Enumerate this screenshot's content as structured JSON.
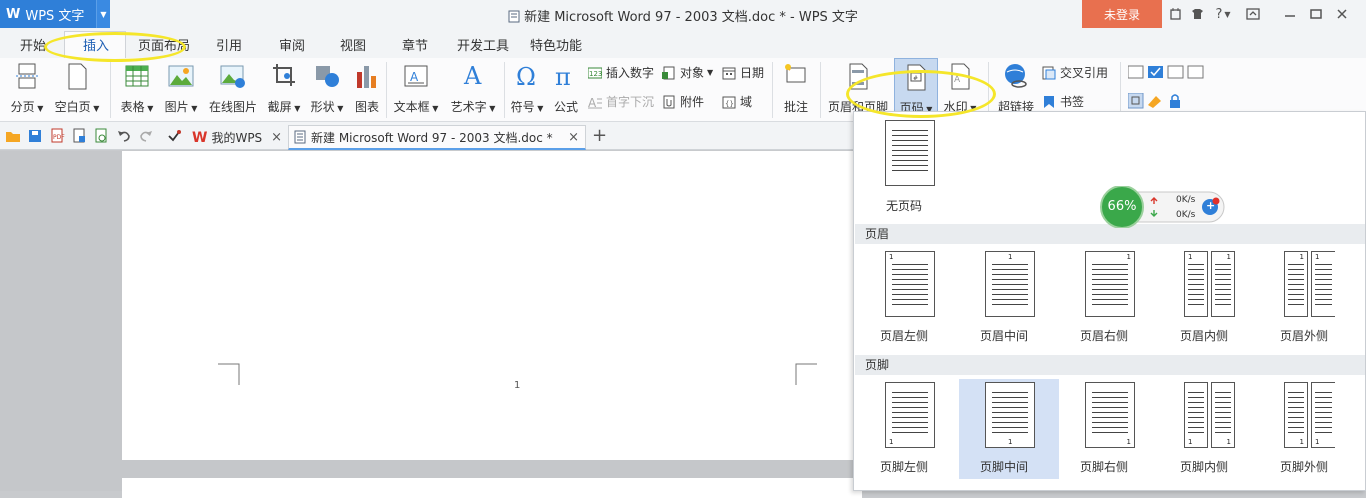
{
  "titlebar": {
    "app_name": "WPS 文字",
    "document_title": "新建 Microsoft Word 97 - 2003 文档.doc * - WPS 文字",
    "login_label": "未登录",
    "help_label": "?"
  },
  "ribbon_tabs": [
    "开始",
    "插入",
    "页面布局",
    "引用",
    "审阅",
    "视图",
    "章节",
    "开发工具",
    "特色功能"
  ],
  "ribbon": {
    "page_break": "分页",
    "blank_page": "空白页",
    "table": "表格",
    "picture": "图片",
    "online_picture": "在线图片",
    "screenshot": "截屏",
    "shape": "形状",
    "chart": "图表",
    "text_box": "文本框",
    "word_art": "艺术字",
    "symbol": "符号",
    "formula": "公式",
    "insert_number": "插入数字",
    "object": "对象",
    "date": "日期",
    "drop_cap": "首字下沉",
    "attachment": "附件",
    "field": "域",
    "comment": "批注",
    "header_footer": "页眉和页脚",
    "page_number": "页码",
    "watermark": "水印",
    "hyperlink": "超链接",
    "cross_ref": "交叉引用",
    "bookmark": "书签"
  },
  "doc_tabs": {
    "my_wps": "我的WPS",
    "current_doc": "新建 Microsoft Word 97 - 2003 文档.doc *",
    "close": "×",
    "add": "+"
  },
  "document": {
    "footer_page_number": "1"
  },
  "dropdown": {
    "none_label": "无页码",
    "header_section": "页眉",
    "footer_section": "页脚",
    "header_options": [
      "页眉左侧",
      "页眉中间",
      "页眉右侧",
      "页眉内侧",
      "页眉外侧"
    ],
    "footer_options": [
      "页脚左侧",
      "页脚中间",
      "页脚右侧",
      "页脚内侧",
      "页脚外侧"
    ],
    "thumb_number": "1"
  },
  "network_widget": {
    "percent": "66%",
    "upload": "0K/s",
    "download": "0K/s"
  },
  "colors": {
    "brand_blue": "#2f7fd8",
    "login_orange": "#e8704f",
    "highlight_yellow": "#f5e62a",
    "selected_option_bg": "#d4e1f5",
    "widget_green": "#3aa84a"
  }
}
